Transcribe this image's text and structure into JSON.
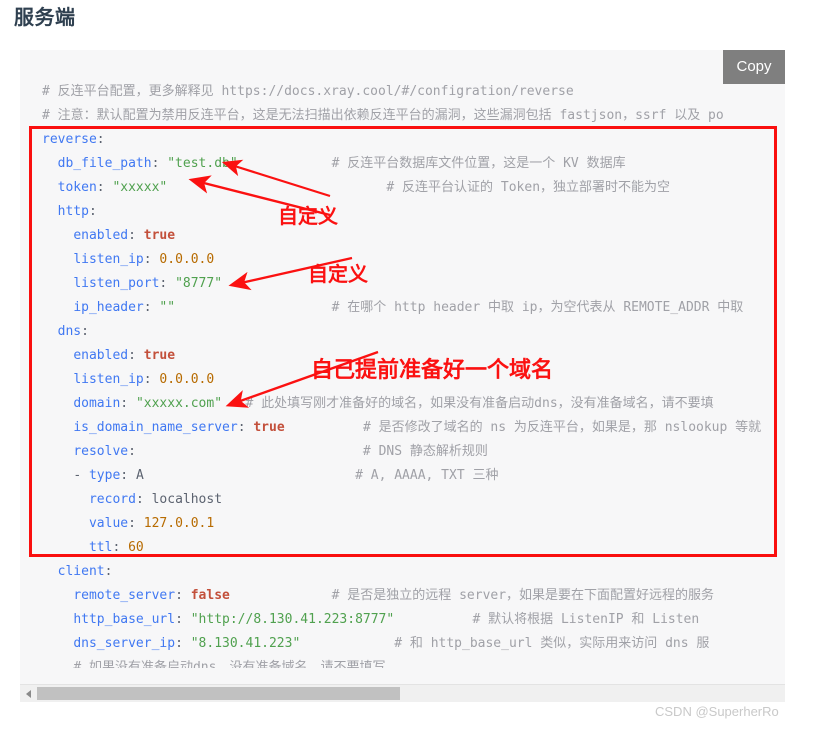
{
  "page": {
    "title": "服务端",
    "watermark": "CSDN @SuperherRo"
  },
  "code_block": {
    "copy_label": "Copy",
    "language": "yaml",
    "lines": [
      "# 反连平台配置，更多解释见 https://docs.xray.cool/#/configration/reverse",
      "# 注意：默认配置为禁用反连平台，这是无法扫描出依赖反连平台的漏洞，这些漏洞包括 fastjson，ssrf 以及 po",
      "reverse:",
      "  db_file_path: \"test.db\"            # 反连平台数据库文件位置，这是一个 KV 数据库",
      "  token: \"xxxxx\"                            # 反连平台认证的 Token，独立部署时不能为空",
      "  http:",
      "    enabled: true",
      "    listen_ip: 0.0.0.0",
      "    listen_port: \"8777\"",
      "    ip_header: \"\"                    # 在哪个 http header 中取 ip，为空代表从 REMOTE_ADDR 中取",
      "  dns:",
      "    enabled: true",
      "    listen_ip: 0.0.0.0",
      "    domain: \"xxxxx.com\"   # 此处填写刚才准备好的域名，如果没有准备启动dns，没有准备域名，请不要填",
      "    is_domain_name_server: true          # 是否修改了域名的 ns 为反连平台，如果是，那 nslookup 等就",
      "    resolve:                             # DNS 静态解析规则",
      "    - type: A                           # A, AAAA, TXT 三种",
      "      record: localhost",
      "      value: 127.0.0.1",
      "      ttl: 60",
      "  client:",
      "    remote_server: false             # 是否是独立的远程 server，如果是要在下面配置好远程的服务",
      "    http_base_url: \"http://8.130.41.223:8777\"          # 默认将根据 ListenIP 和 Listen",
      "    dns_server_ip: \"8.130.41.223\"            # 和 http_base_url 类似，实际用来访问 dns 服",
      "    # 如果没有准备启动dns，没有准备域名，请不要填写"
    ],
    "scrollbar": {
      "left_arrow": "◀"
    }
  },
  "annotations": {
    "highlight_box_color": "#fa0f0f",
    "labels": [
      {
        "text": "自定义",
        "target": "token"
      },
      {
        "text": "自定义",
        "target": "listen_port"
      },
      {
        "text": "自己提前准备好一个域名",
        "target": "domain"
      }
    ]
  }
}
